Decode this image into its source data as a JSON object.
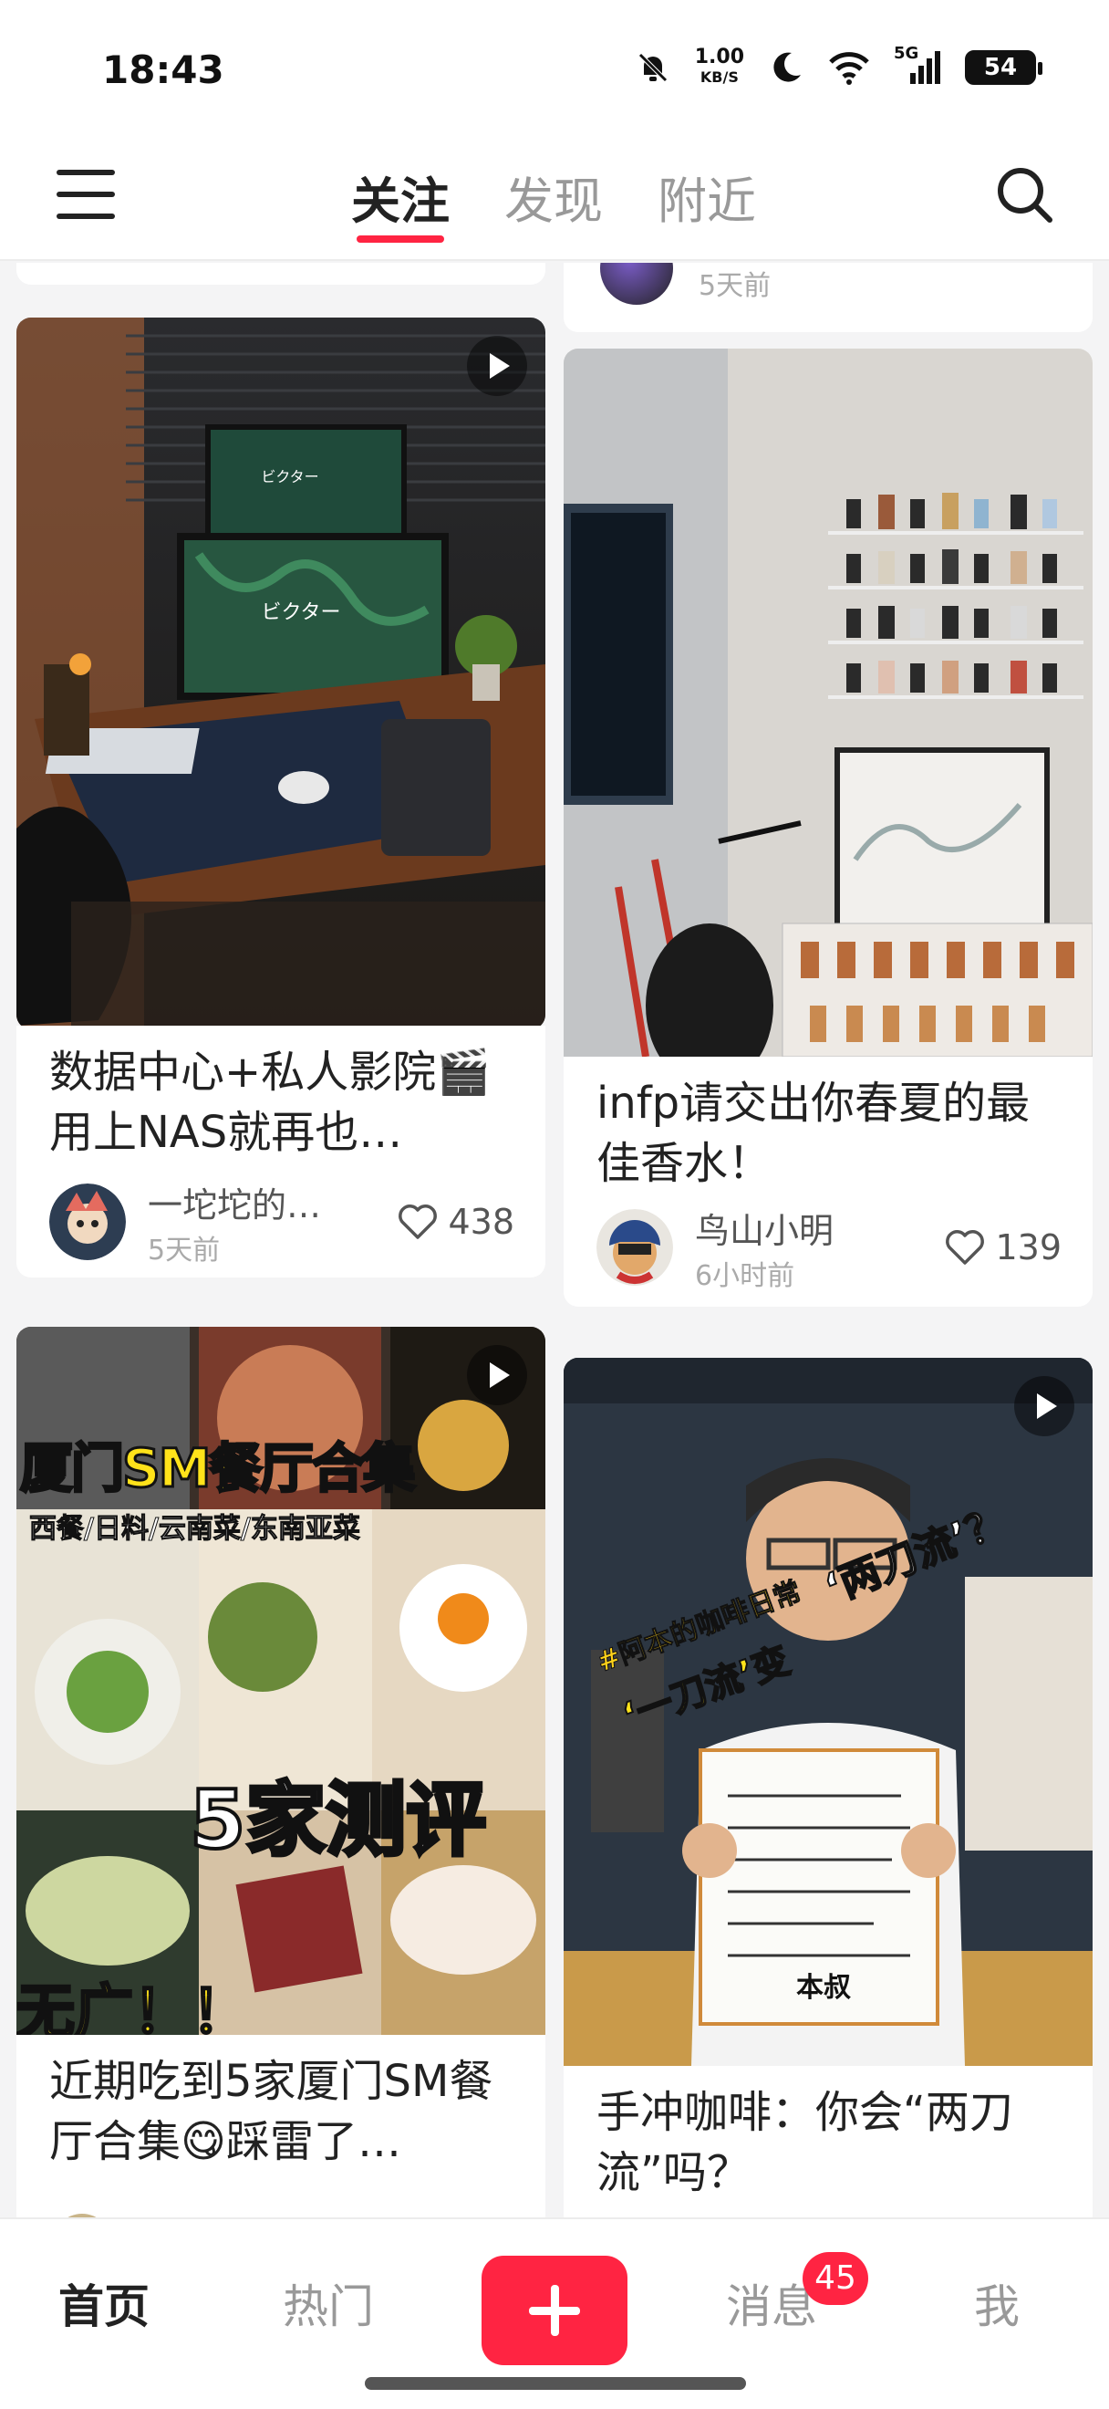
{
  "status": {
    "time": "18:43",
    "net_speed_top": "1.00",
    "net_speed_unit": "KB/S",
    "battery": "54",
    "signal_label": "5G"
  },
  "topnav": {
    "tabs": [
      {
        "label": "关注"
      },
      {
        "label": "发现"
      },
      {
        "label": "附近"
      }
    ],
    "active_tab": "关注"
  },
  "feed": {
    "partial_card": {
      "time": "5天前"
    },
    "cards": [
      {
        "title": "数据中心+私人影院🎬用上NAS就再也…",
        "author": "一坨坨的…",
        "time": "5天前",
        "likes": "438",
        "video": true,
        "overlay_text": "ビクター"
      },
      {
        "title": "infp请交出你春夏的最佳香水！",
        "author": "鸟山小明",
        "time": "6小时前",
        "likes": "139",
        "video": false
      },
      {
        "title": "近期吃到5家厦门SM餐厅合集😋踩雷了…",
        "author": "",
        "time": "",
        "likes": "",
        "video": true,
        "overlay": {
          "headline": "厦门SM餐厅合集",
          "subline": "西餐/日料/云南菜/东南亚菜",
          "big": "5家测评",
          "tag": "无广！！"
        }
      },
      {
        "title": "手冲咖啡：你会“两刀流”吗？",
        "author": "",
        "time": "",
        "likes": "",
        "video": true,
        "overlay": {
          "tag1": "#阿本的咖啡日常",
          "tag2": "‘一刀流’变",
          "tag3": "‘两刀流’？",
          "sign": "本叔"
        }
      }
    ]
  },
  "bottombar": {
    "home": "首页",
    "hot": "热门",
    "messages": "消息",
    "messages_badge": "45",
    "me": "我"
  },
  "colors": {
    "accent": "#ff2442"
  }
}
